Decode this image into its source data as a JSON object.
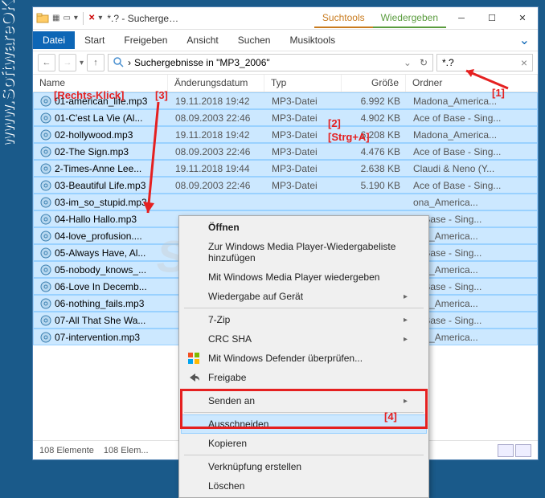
{
  "watermarkSide": "www.SoftwareOK.de :-)",
  "watermarkCenter": "SoftwareOK",
  "titlebar": {
    "titleText": "*.? - Sucherge…",
    "toolTabs": {
      "search": "Suchtools",
      "play": "Wiedergeben"
    }
  },
  "ribbon": {
    "file": "Datei",
    "start": "Start",
    "share": "Freigeben",
    "view": "Ansicht",
    "search": "Suchen",
    "music": "Musiktools"
  },
  "breadcrumb": "Suchergebnisse in \"MP3_2006\"",
  "searchValue": "*.?",
  "columns": {
    "name": "Name",
    "date": "Änderungsdatum",
    "type": "Typ",
    "size": "Größe",
    "folder": "Ordner"
  },
  "rows": [
    {
      "n": "01-american_life.mp3",
      "d": "19.11.2018 19:42",
      "t": "MP3-Datei",
      "s": "6.992 KB",
      "f": "Madona_America..."
    },
    {
      "n": "01-C'est La Vie (Al...",
      "d": "08.09.2003 22:46",
      "t": "MP3-Datei",
      "s": "4.902 KB",
      "f": "Ace of Base - Sing..."
    },
    {
      "n": "02-hollywood.mp3",
      "d": "19.11.2018 19:42",
      "t": "MP3-Datei",
      "s": "6.208 KB",
      "f": "Madona_America..."
    },
    {
      "n": "02-The Sign.mp3",
      "d": "08.09.2003 22:46",
      "t": "MP3-Datei",
      "s": "4.476 KB",
      "f": "Ace of Base - Sing..."
    },
    {
      "n": "2-Times-Anne Lee...",
      "d": "19.11.2018 19:44",
      "t": "MP3-Datei",
      "s": "2.638 KB",
      "f": "Claudi & Neno (Y..."
    },
    {
      "n": "03-Beautiful Life.mp3",
      "d": "08.09.2003 22:46",
      "t": "MP3-Datei",
      "s": "5.190 KB",
      "f": "Ace of Base - Sing..."
    },
    {
      "n": "03-im_so_stupid.mp3",
      "d": "",
      "t": "",
      "s": "",
      "f": "ona_America..."
    },
    {
      "n": "04-Hallo Hallo.mp3",
      "d": "",
      "t": "",
      "s": "",
      "f": "of Base - Sing..."
    },
    {
      "n": "04-love_profusion....",
      "d": "",
      "t": "",
      "s": "",
      "f": "ona_America..."
    },
    {
      "n": "05-Always Have, Al...",
      "d": "",
      "t": "",
      "s": "",
      "f": "of Base - Sing..."
    },
    {
      "n": "05-nobody_knows_...",
      "d": "",
      "t": "",
      "s": "",
      "f": "ona_America..."
    },
    {
      "n": "06-Love In Decemb...",
      "d": "",
      "t": "",
      "s": "",
      "f": "of Base - Sing..."
    },
    {
      "n": "06-nothing_fails.mp3",
      "d": "",
      "t": "",
      "s": "",
      "f": "ona_America..."
    },
    {
      "n": "07-All That She Wa...",
      "d": "",
      "t": "",
      "s": "",
      "f": "of Base - Sing..."
    },
    {
      "n": "07-intervention.mp3",
      "d": "",
      "t": "",
      "s": "",
      "f": "ona_America..."
    }
  ],
  "status": {
    "items": "108 Elemente",
    "selected": "108 Elem..."
  },
  "ctx": {
    "open": "Öffnen",
    "wmpAdd": "Zur Windows Media Player-Wiedergabeliste hinzufügen",
    "wmpPlay": "Mit Windows Media Player wiedergeben",
    "device": "Wiedergabe auf Gerät",
    "sevenZip": "7-Zip",
    "crc": "CRC SHA",
    "defender": "Mit Windows Defender überprüfen...",
    "share": "Freigabe",
    "sendTo": "Senden an",
    "cut": "Ausschneiden",
    "copy": "Kopieren",
    "shortcut": "Verknüpfung erstellen",
    "delete": "Löschen"
  },
  "annotations": {
    "a1": "[1]",
    "a2": "[2]",
    "a3": "[3]",
    "a4": "[4]",
    "rclick": "[Rechts-Klick]",
    "ctrlA": "[Strg+A]"
  }
}
